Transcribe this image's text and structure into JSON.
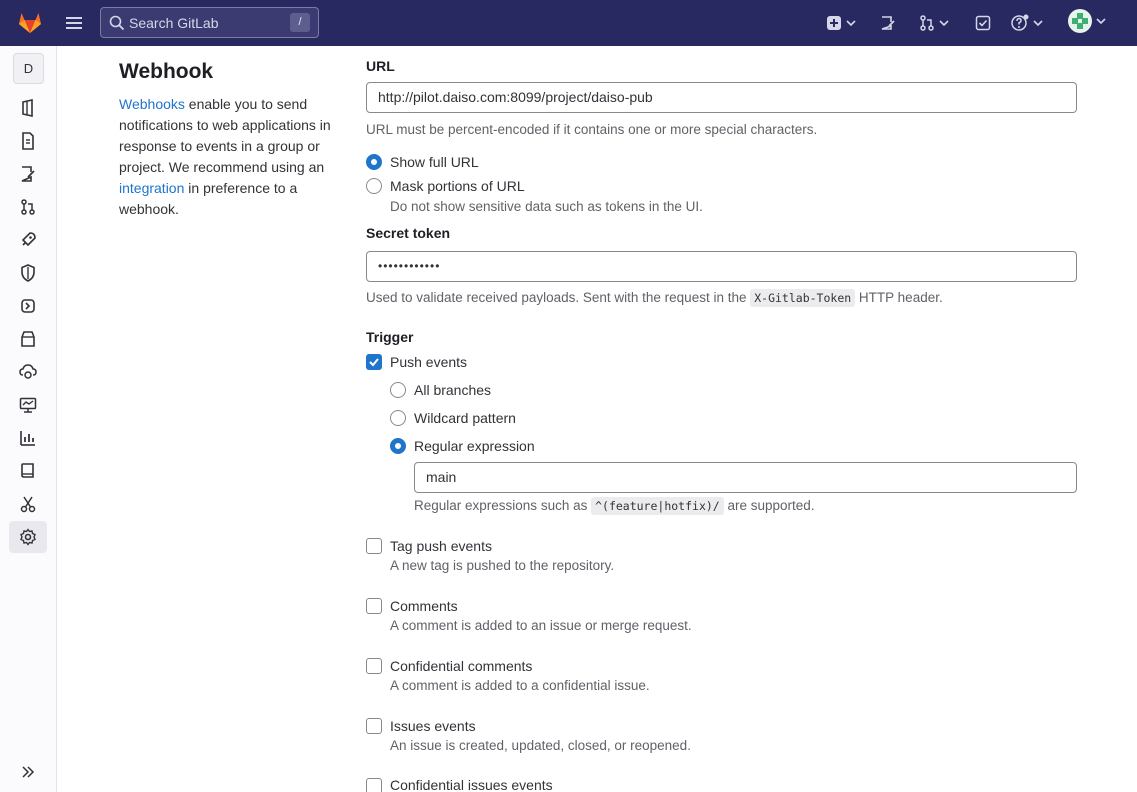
{
  "search": {
    "placeholder": "Search GitLab",
    "shortcut": "/"
  },
  "sidebar": {
    "avatar_letter": "D"
  },
  "page": {
    "title": "Webhook",
    "desc_link1": "Webhooks",
    "desc_text1": " enable you to send notifications to web applications in response to events in a group or project. We recommend using an ",
    "desc_link2": "integration",
    "desc_text2": " in preference to a webhook."
  },
  "url": {
    "label": "URL",
    "value": "http://pilot.daiso.com:8099/project/daiso-pub",
    "help": "URL must be percent-encoded if it contains one or more special characters.",
    "show_full": "Show full URL",
    "mask": "Mask portions of URL",
    "mask_help": "Do not show sensitive data such as tokens in the UI."
  },
  "token": {
    "label": "Secret token",
    "value": "••••••••••••",
    "help_before": "Used to validate received payloads. Sent with the request in the ",
    "help_code": "X-Gitlab-Token",
    "help_after": " HTTP header."
  },
  "trigger": {
    "label": "Trigger",
    "push": "Push events",
    "all_branches": "All branches",
    "wildcard": "Wildcard pattern",
    "regex": "Regular expression",
    "regex_value": "main",
    "regex_help_before": "Regular expressions such as ",
    "regex_help_code": "^(feature|hotfix)/",
    "regex_help_after": " are supported.",
    "events": [
      {
        "label": "Tag push events",
        "desc": "A new tag is pushed to the repository."
      },
      {
        "label": "Comments",
        "desc": "A comment is added to an issue or merge request."
      },
      {
        "label": "Confidential comments",
        "desc": "A comment is added to a confidential issue."
      },
      {
        "label": "Issues events",
        "desc": "An issue is created, updated, closed, or reopened."
      },
      {
        "label": "Confidential issues events",
        "desc": ""
      }
    ]
  },
  "colors": {
    "topbar": "#292961",
    "accent": "#1f75cb",
    "link": "#1f75cb"
  }
}
